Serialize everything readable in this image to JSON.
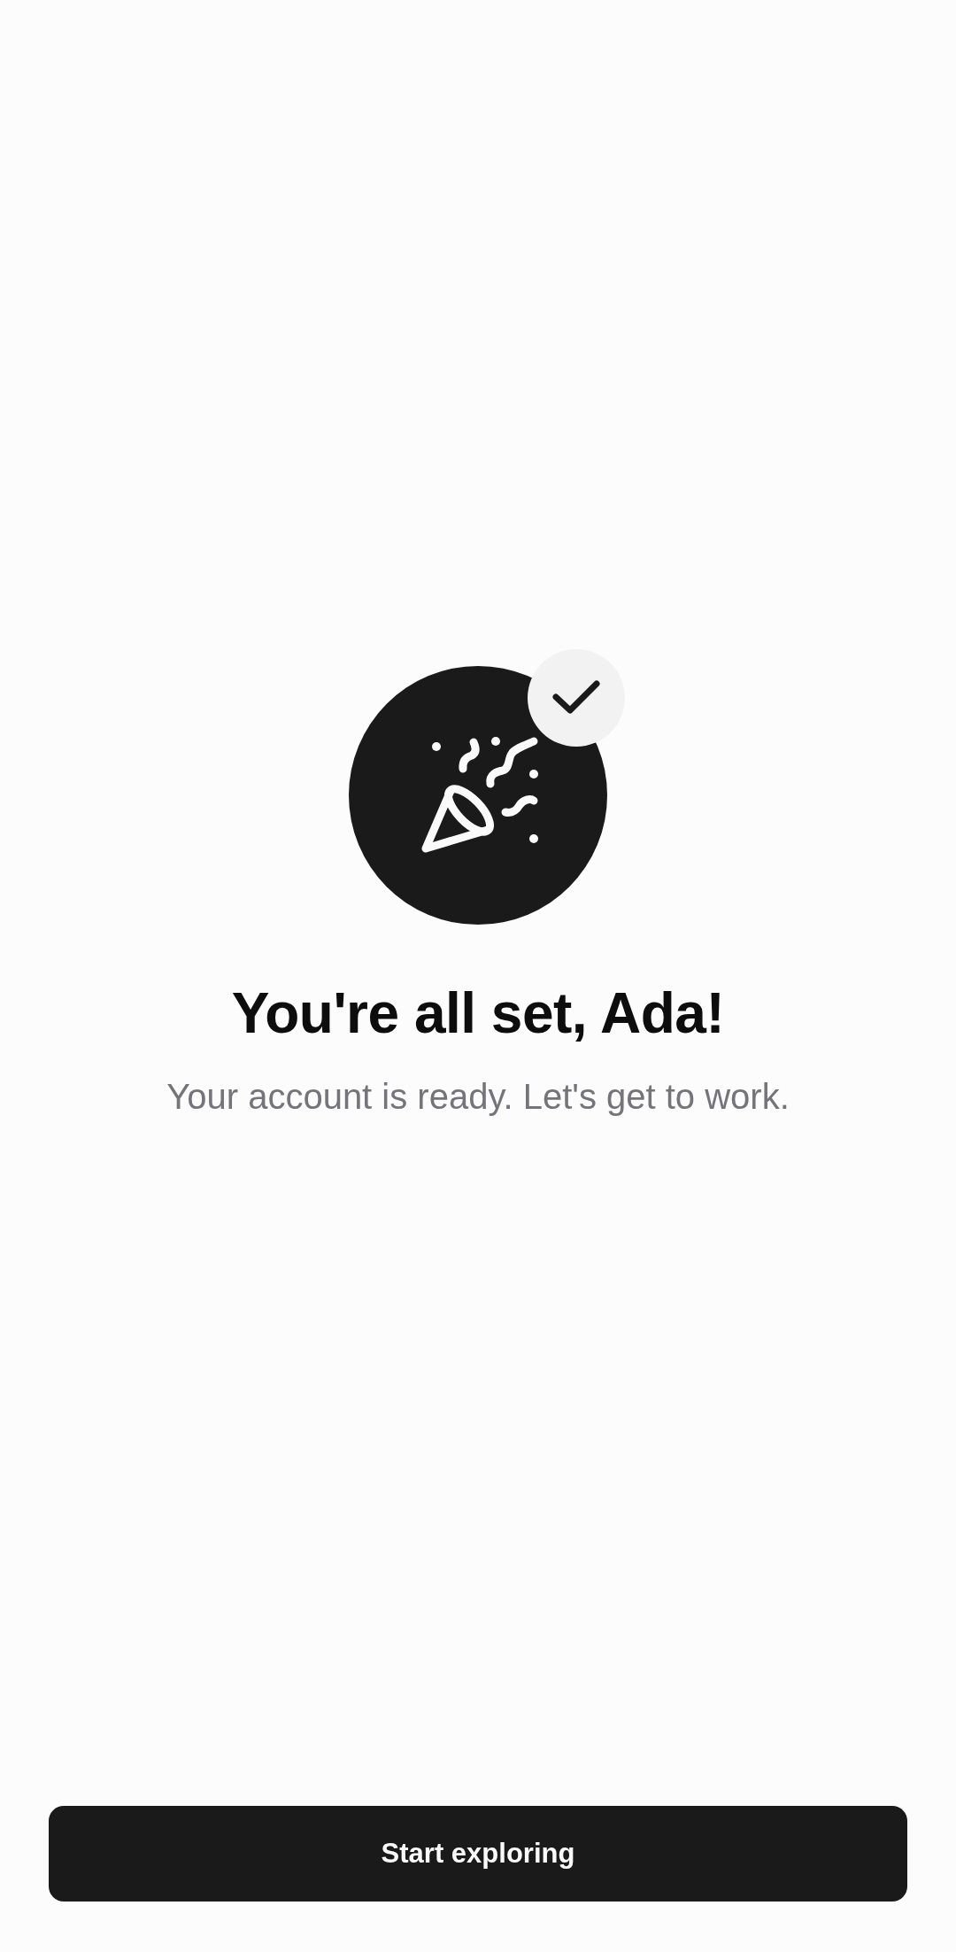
{
  "title": "You're all set, Ada!",
  "subtitle": "Your account is ready. Let's get to work.",
  "primary_button": {
    "label": "Start exploring"
  }
}
